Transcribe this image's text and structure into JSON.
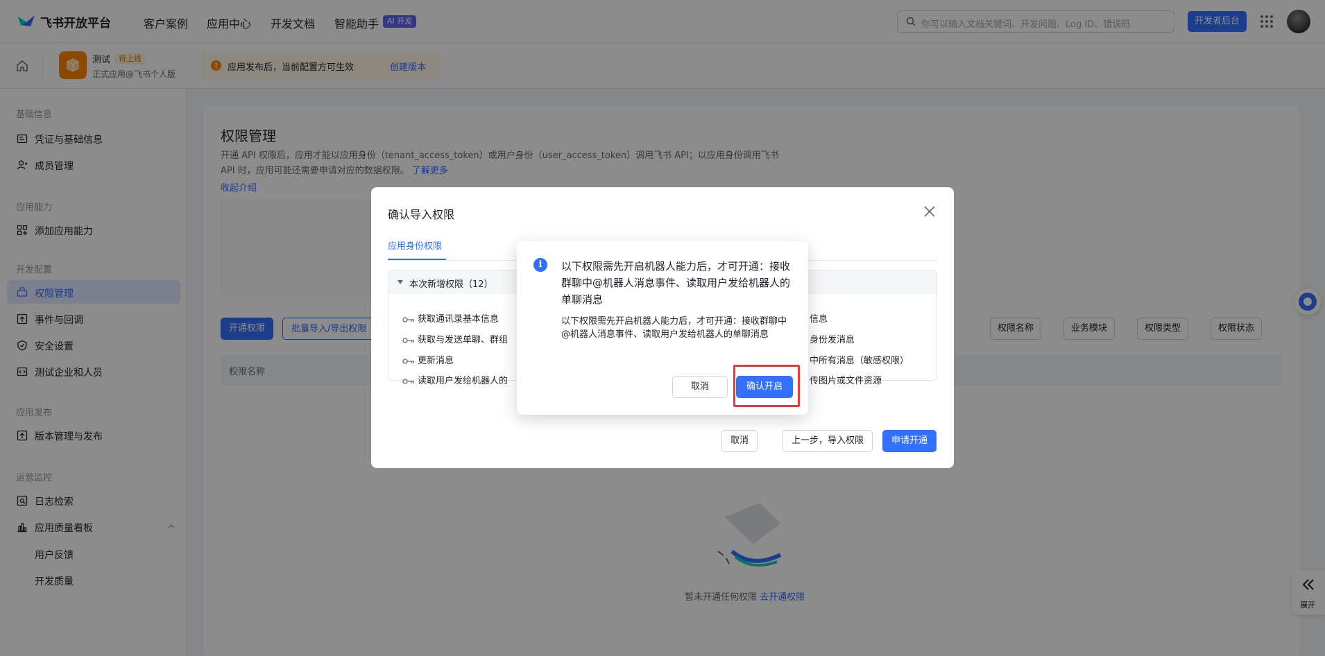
{
  "topnav": {
    "brand": "飞书开放平台",
    "items": [
      "客户案例",
      "应用中心",
      "开发文档",
      "智能助手"
    ],
    "ai_badge": "AI 开发",
    "search_placeholder": "你可以输入文档关键词、开发问题、Log ID、错误码",
    "dev_console": "开发者后台"
  },
  "subbar": {
    "app_name": "测试",
    "app_status": "待上线",
    "app_sub": "正式应用@飞书个人版",
    "notice_text": "应用发布后，当前配置方可生效",
    "notice_link": "创建版本"
  },
  "sidebar": {
    "groups": [
      {
        "title": "基础信息",
        "items": [
          "凭证与基础信息",
          "成员管理"
        ]
      },
      {
        "title": "应用能力",
        "items": [
          "添加应用能力"
        ]
      },
      {
        "title": "开发配置",
        "items": [
          "权限管理",
          "事件与回调",
          "安全设置",
          "测试企业和人员"
        ]
      },
      {
        "title": "应用发布",
        "items": [
          "版本管理与发布"
        ]
      },
      {
        "title": "运营监控",
        "items": [
          "日志检索",
          "应用质量看板"
        ]
      }
    ],
    "sub_items": [
      "用户反馈",
      "开发质量"
    ]
  },
  "main": {
    "title": "权限管理",
    "desc": "开通 API 权限后，应用才能以应用身份（tenant_access_token）或用户身份（user_access_token）调用飞书 API；以应用身份调用飞书 API 时，应用可能还需要申请对应的数据权限。",
    "desc_link": "了解更多",
    "collapse": "收起介绍",
    "btn_open": "开通权限",
    "btn_batch": "批量导入/导出权限",
    "filters": [
      "权限名称",
      "业务模块",
      "权限类型",
      "权限状态"
    ],
    "table_header": "权限名称",
    "empty_text": "暂未开通任何权限",
    "empty_link": "去开通权限"
  },
  "dialog": {
    "title": "确认导入权限",
    "tab": "应用身份权限",
    "perm_header": "本次新增权限（12）",
    "perms_left": [
      "获取通讯录基本信息",
      "获取与发送单聊、群组",
      "更新消息",
      "读取用户发给机器人的"
    ],
    "perms_right": [
      "信息",
      "身份发消息",
      "中所有消息（敏感权限）",
      "传图片或文件资源"
    ],
    "cancel": "取消",
    "prev": "上一步，导入权限",
    "apply": "申请开通"
  },
  "confirm": {
    "icon": "i",
    "title": "以下权限需先开启机器人能力后，才可开通：接收群聊中@机器人消息事件、读取用户发给机器人的单聊消息",
    "body": "以下权限需先开启机器人能力后，才可开通：接收群聊中@机器人消息事件、读取用户发给机器人的单聊消息",
    "cancel": "取消",
    "ok": "确认开启"
  },
  "float": {
    "expand": "展开"
  },
  "colors": {
    "primary": "#3370ff",
    "highlight": "#e8393b",
    "app_icon": "#ff8800"
  }
}
